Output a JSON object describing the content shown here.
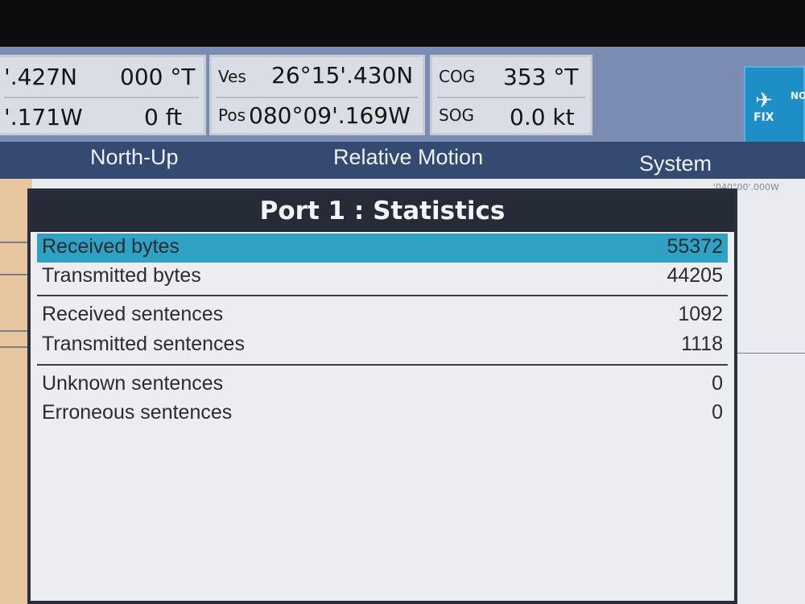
{
  "nav_panels": {
    "left": {
      "lat": "'.427N",
      "heading": "000 °T",
      "lon": "'.171W",
      "depth": "0 ft"
    },
    "vessel": {
      "label_top": "Ves",
      "lat": "26°15'.430N",
      "label_bottom": "Pos",
      "lon": "080°09'.169W"
    },
    "course": {
      "cog_label": "COG",
      "cog_value": "353 °T",
      "sog_label": "SOG",
      "sog_value": "0.0 kt"
    }
  },
  "fix_button": {
    "label": "FIX",
    "secondary": "NO"
  },
  "menu": {
    "orientation": "North-Up",
    "motion": "Relative Motion",
    "system": "System"
  },
  "chart": {
    "coord_right": "'040°00'.000W"
  },
  "dialog": {
    "title": "Port 1 : Statistics",
    "rows": [
      {
        "label": "Received bytes",
        "value": "55372",
        "selected": true
      },
      {
        "label": "Transmitted bytes",
        "value": "44205"
      },
      {
        "label": "Received sentences",
        "value": "1092"
      },
      {
        "label": "Transmitted sentences",
        "value": "1118"
      },
      {
        "label": "Unknown sentences",
        "value": "0"
      },
      {
        "label": "Erroneous sentences",
        "value": "0"
      }
    ]
  },
  "colors": {
    "selection": "#2fa1c3",
    "title_bar": "#262b38",
    "menu_bar": "#344a70",
    "fix_button": "#1e8fc6"
  },
  "icons": {
    "fix": "satellite-icon"
  }
}
